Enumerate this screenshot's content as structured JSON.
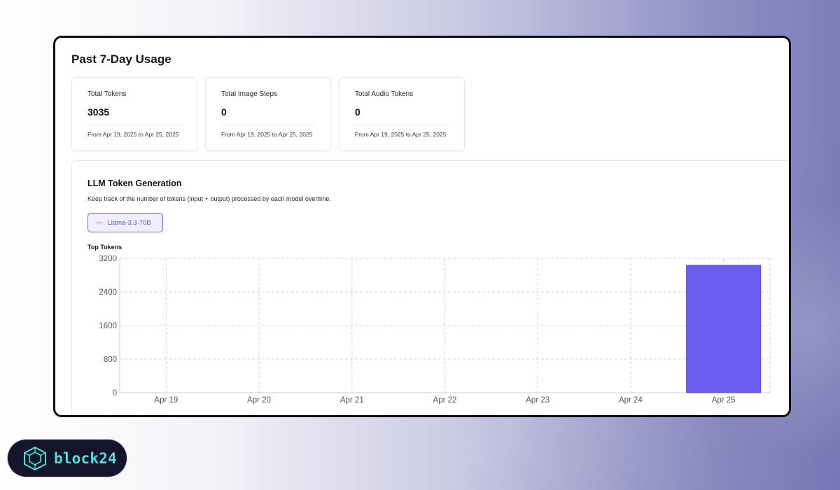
{
  "page": {
    "title": "Past 7-Day Usage"
  },
  "stats": [
    {
      "label": "Total Tokens",
      "value": "3035",
      "range": "From Apr 19, 2025 to Apr 25, 2025"
    },
    {
      "label": "Total Image Steps",
      "value": "0",
      "range": "From Apr 19, 2025 to Apr 25, 2025"
    },
    {
      "label": "Total Audio Tokens",
      "value": "0",
      "range": "From Apr 19, 2025 to Apr 25, 2025"
    }
  ],
  "llm": {
    "title": "LLM Token Generation",
    "description": "Keep track of the number of tokens (input + output) processed by each model overtime.",
    "model_chip": {
      "icon": "commit-icon",
      "label": "Llama-3.3-70B"
    },
    "section_label": "Top Tokens"
  },
  "chart_data": {
    "type": "bar",
    "categories": [
      "Apr 19",
      "Apr 20",
      "Apr 21",
      "Apr 22",
      "Apr 23",
      "Apr 24",
      "Apr 25"
    ],
    "series": [
      {
        "values": [
          0,
          0,
          0,
          0,
          0,
          0,
          3035
        ],
        "color": "#6a5cec"
      }
    ],
    "title": "",
    "xlabel": "",
    "ylabel": "",
    "ylim": [
      0,
      3200
    ],
    "yticks": [
      0,
      800,
      1600,
      2400,
      3200
    ],
    "grid": true,
    "grid_style": "dashed",
    "legend": "none"
  },
  "brand": {
    "logo_text": "block24",
    "logo_icon": "cube-logo-icon",
    "accent": "#4be0dd"
  },
  "colors": {
    "accent": "#6a5cec",
    "chip_border": "#6b6bd6",
    "chip_bg": "#efeffb"
  }
}
